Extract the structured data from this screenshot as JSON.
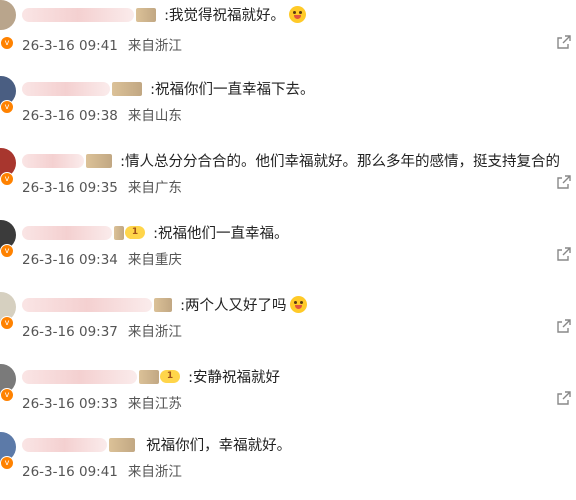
{
  "comments": [
    {
      "text": ":我觉得祝福就好。",
      "date": "26-3-16 09:41",
      "location": "来自浙江",
      "emoji": "grinning-emoji",
      "share": true,
      "badge": ""
    },
    {
      "text": ":祝福你们一直幸福下去。",
      "date": "26-3-16 09:38",
      "location": "来自山东",
      "share": false,
      "badge": ""
    },
    {
      "text": ":情人总分分合合的。他们幸福就好。那么多年的感情，挺支持复合的",
      "date": "26-3-16 09:35",
      "location": "来自广东",
      "share": true,
      "badge": ""
    },
    {
      "text": ":祝福他们一直幸福。",
      "date": "26-3-16 09:34",
      "location": "来自重庆",
      "share": true,
      "badge": "1"
    },
    {
      "text": ":两个人又好了吗",
      "date": "26-3-16 09:37",
      "location": "来自浙江",
      "emoji": "laughing-emoji",
      "share": true,
      "badge": ""
    },
    {
      "text": ":安静祝福就好",
      "date": "26-3-16 09:33",
      "location": "来自江苏",
      "share": true,
      "badge": "1"
    },
    {
      "text": "祝福你们，幸福就好。",
      "date": "26-3-16 09:41",
      "location": "来自浙江",
      "share": true,
      "badge": ""
    }
  ],
  "colors": {
    "accent": "#ff8200",
    "text": "#222222",
    "meta": "#555555"
  }
}
